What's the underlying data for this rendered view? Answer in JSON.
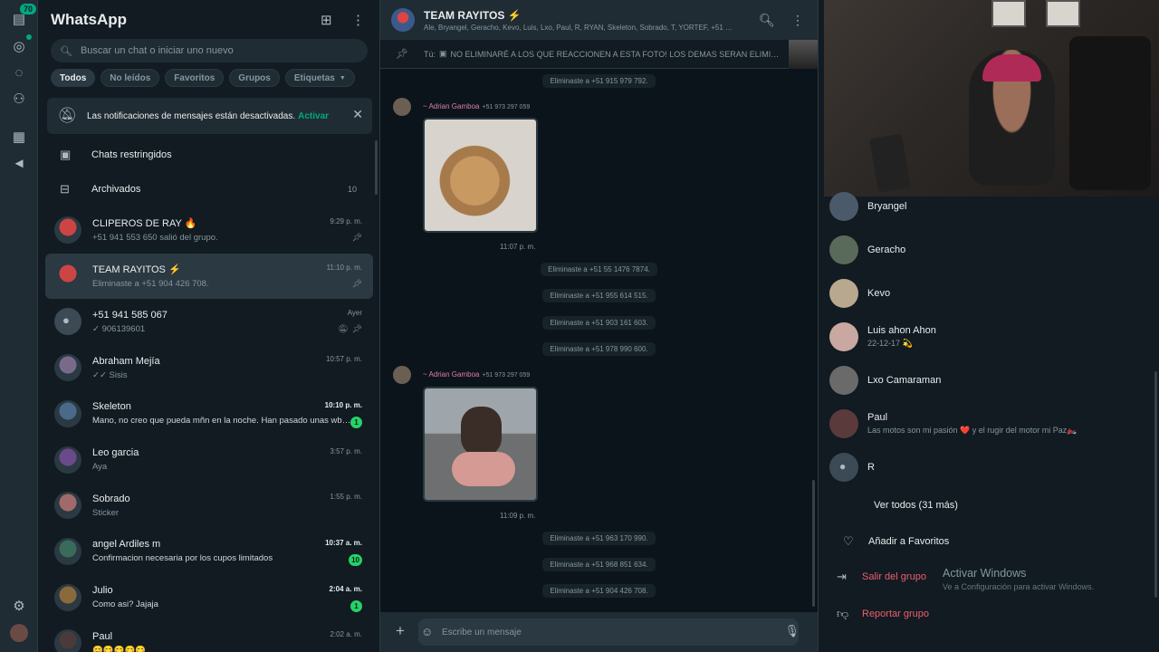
{
  "rail": {
    "badge": "70",
    "icons": [
      "chats-icon",
      "status-icon",
      "channels-icon",
      "communities-icon",
      "catalog-icon",
      "megaphone-icon",
      "settings-icon",
      "profile-avatar"
    ]
  },
  "sidebar": {
    "title": "WhatsApp",
    "search_placeholder": "Buscar un chat o iniciar uno nuevo",
    "filters": [
      "Todos",
      "No leídos",
      "Favoritos",
      "Grupos",
      "Etiquetas"
    ],
    "notice_text": "Las notificaciones de mensajes están desactivadas.",
    "notice_action": "Activar",
    "restricted": "Chats restringidos",
    "archived": "Archivados",
    "archived_count": "10",
    "chats": [
      {
        "name": "CLIPEROS DE RAY 🔥",
        "preview": "+51 941 553 650 salió del grupo.",
        "time": "9:29 p. m.",
        "unread": "",
        "pinned": true,
        "muted": false,
        "bold": false
      },
      {
        "name": "TEAM RAYITOS ⚡",
        "preview": "Eliminaste a +51 904 426 708.",
        "time": "11:10 p. m.",
        "unread": "",
        "pinned": true,
        "muted": false,
        "bold": false
      },
      {
        "name": "+51 941 585 067",
        "preview": "✓ 906139601",
        "time": "Ayer",
        "unread": "",
        "pinned": true,
        "muted": true,
        "bold": false
      },
      {
        "name": "Abraham Mejía",
        "preview": "✓✓ Sisis",
        "time": "10:57 p. m.",
        "unread": "",
        "pinned": false,
        "muted": false,
        "bold": false
      },
      {
        "name": "Skeleton",
        "preview": "Mano, no creo que pueda mñn en la noche. Han pasado unas wb…",
        "time": "10:10 p. m.",
        "unread": "1",
        "pinned": false,
        "muted": false,
        "bold": true
      },
      {
        "name": "Leo garcia",
        "preview": "Aya",
        "time": "3:57 p. m.",
        "unread": "",
        "pinned": false,
        "muted": false,
        "bold": false
      },
      {
        "name": "Sobrado",
        "preview": "Sticker",
        "time": "1:55 p. m.",
        "unread": "",
        "pinned": false,
        "muted": false,
        "bold": false
      },
      {
        "name": "angel Ardiles m",
        "preview": "Confirmacion necesaria por los cupos limitados",
        "time": "10:37 a. m.",
        "unread": "10",
        "pinned": false,
        "muted": false,
        "bold": true
      },
      {
        "name": "Julio",
        "preview": "Como asi? Jajaja",
        "time": "2:04 a. m.",
        "unread": "1",
        "pinned": false,
        "muted": false,
        "bold": true
      },
      {
        "name": "Paul",
        "preview": "😊😋😋😋😋",
        "time": "2:02 a. m.",
        "unread": "",
        "pinned": false,
        "muted": false,
        "bold": false
      }
    ]
  },
  "conversation": {
    "title": "TEAM RAYITOS ⚡",
    "members": "Ale, Bryangel, Geracho, Kevo, Luis, Lxo, Paul, R, RYAN, Skeleton, Sobrado, T, YORTEF, +51 …",
    "pinned_prefix": "Tú:",
    "pinned_text": "NO ELIMINARÉ A LOS QUE REACCIONEN A ESTA FOTO!  LOS DEMAS SERAN ELIMI…",
    "system_msgs": [
      "Eliminaste a +51 915 979 792.",
      "Eliminaste a +51 55 1476 7874.",
      "Eliminaste a +51 955 614 515.",
      "Eliminaste a +51 903 161 603.",
      "Eliminaste a +51 978 990 600.",
      "Eliminaste a +51 963 170 990.",
      "Eliminaste a +51 968 851 634.",
      "Eliminaste a +51 904 426 708."
    ],
    "sender_name": "~ Adrian Gamboa",
    "sender_phone": "+51 973 297 059",
    "image_times": [
      "11:07 p. m.",
      "11:09 p. m."
    ],
    "compose_placeholder": "Escribe un mensaje"
  },
  "info": {
    "members": [
      {
        "name": "Bryangel",
        "status": ""
      },
      {
        "name": "Geracho",
        "status": ""
      },
      {
        "name": "Kevo",
        "status": ""
      },
      {
        "name": "Luis ahon Ahon",
        "status": "22-12-17 💫"
      },
      {
        "name": "Lxo Camaraman",
        "status": ""
      },
      {
        "name": "Paul",
        "status": "Las motos son mi pasión ❤️ y el rugir del motor mi Paz🏍️"
      },
      {
        "name": "R",
        "status": ""
      }
    ],
    "see_all": "Ver todos (31 más)",
    "add_favorites": "Añadir a Favoritos",
    "leave_group": "Salir del grupo",
    "report_group": "Reportar grupo",
    "watermark_title": "Activar Windows",
    "watermark_sub": "Ve a Configuración para activar Windows."
  }
}
